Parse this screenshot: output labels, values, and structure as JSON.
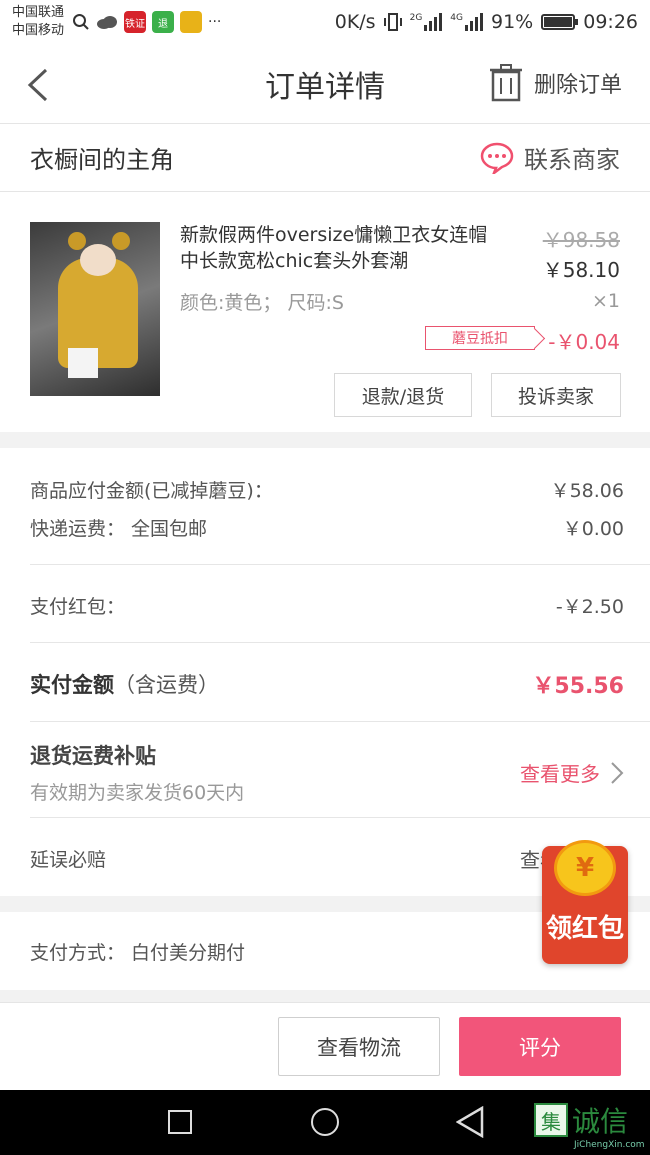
{
  "status_bar": {
    "carrier1": "中国联通",
    "carrier2": "中国移动",
    "speed": "0K/s",
    "battery": "91%",
    "time": "09:26",
    "network_1": "2G",
    "network_2": "4G",
    "battery_level": 0.91,
    "app_badge_1": "铁证",
    "app_badge_2": "退"
  },
  "nav": {
    "title": "订单详情",
    "delete_label": "删除订单"
  },
  "shop": {
    "name": "衣橱间的主角",
    "contact_label": "联系商家"
  },
  "product": {
    "title": "新款假两件oversize慵懒卫衣女连帽中长款宽松chic套头外套潮",
    "spec": "颜色:黄色；  尺码:S",
    "price_old": "￥98.58",
    "price_new": "￥58.10",
    "qty": "×1",
    "discount_tag": "蘑豆抵扣",
    "discount_amount": "-￥0.04",
    "refund_button": "退款/退货",
    "complain_button": "投诉卖家"
  },
  "amounts": {
    "goods_label": "商品应付金额(已减掉蘑豆)：",
    "goods_value": "￥58.06",
    "shipping_label": "快递运费：  全国包邮",
    "shipping_value": "￥0.00",
    "redpack_label": "支付红包：",
    "redpack_value": "-￥2.50",
    "total_label": "实付金额",
    "total_sub": "（含运费）",
    "total_value": "￥55.56",
    "return_title": "退货运费补贴",
    "return_sub": "有效期为卖家发货60天内",
    "return_link": "查看更多",
    "delay_label": "延误必赔",
    "delay_link": "查看详情"
  },
  "payment": {
    "label": "支付方式：  白付美分期付"
  },
  "actions": {
    "logistics": "查看物流",
    "rate": "评分"
  },
  "float": {
    "coin": "¥",
    "text": "领红包"
  },
  "watermark": {
    "text": "诚信",
    "box": "集",
    "small": "JiChengXin.com"
  },
  "colors": {
    "accent": "#e9536e",
    "primary_button": "#f2557a",
    "red_packet": "#e0452c"
  }
}
